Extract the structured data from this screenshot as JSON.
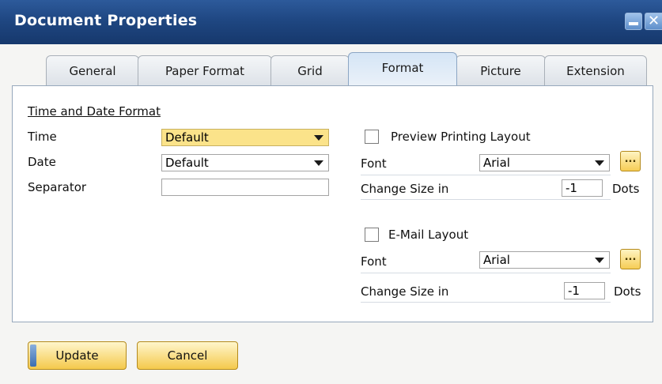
{
  "window": {
    "title": "Document Properties",
    "minimize_icon": "minimize-icon",
    "close_icon": "close-icon",
    "close_glyph": "✕"
  },
  "tabs": [
    {
      "label": "General"
    },
    {
      "label": "Paper Format"
    },
    {
      "label": "Grid"
    },
    {
      "label": "Format"
    },
    {
      "label": "Picture"
    },
    {
      "label": "Extension"
    }
  ],
  "active_tab": "Format",
  "time_date": {
    "heading": "Time and Date Format",
    "time_label": "Time",
    "time_value": "Default",
    "date_label": "Date",
    "date_value": "Default",
    "separator_label": "Separator",
    "separator_value": ""
  },
  "preview": {
    "checkbox_label": "Preview Printing Layout",
    "checked": false,
    "font_label": "Font",
    "font_value": "Arial",
    "size_label": "Change Size in",
    "size_value": "-1",
    "size_unit": "Dots",
    "ellipsis": "..."
  },
  "email": {
    "checkbox_label": "E-Mail Layout",
    "checked": false,
    "font_label": "Font",
    "font_value": "Arial",
    "size_label": "Change Size in",
    "size_value": "-1",
    "size_unit": "Dots",
    "ellipsis": "..."
  },
  "buttons": {
    "update": "Update",
    "cancel": "Cancel"
  },
  "colors": {
    "title_bar": "#1f4782",
    "highlight_field": "#fbe38a",
    "button_gold": "#f4c94c",
    "active_tab": "#d5e5f6"
  }
}
